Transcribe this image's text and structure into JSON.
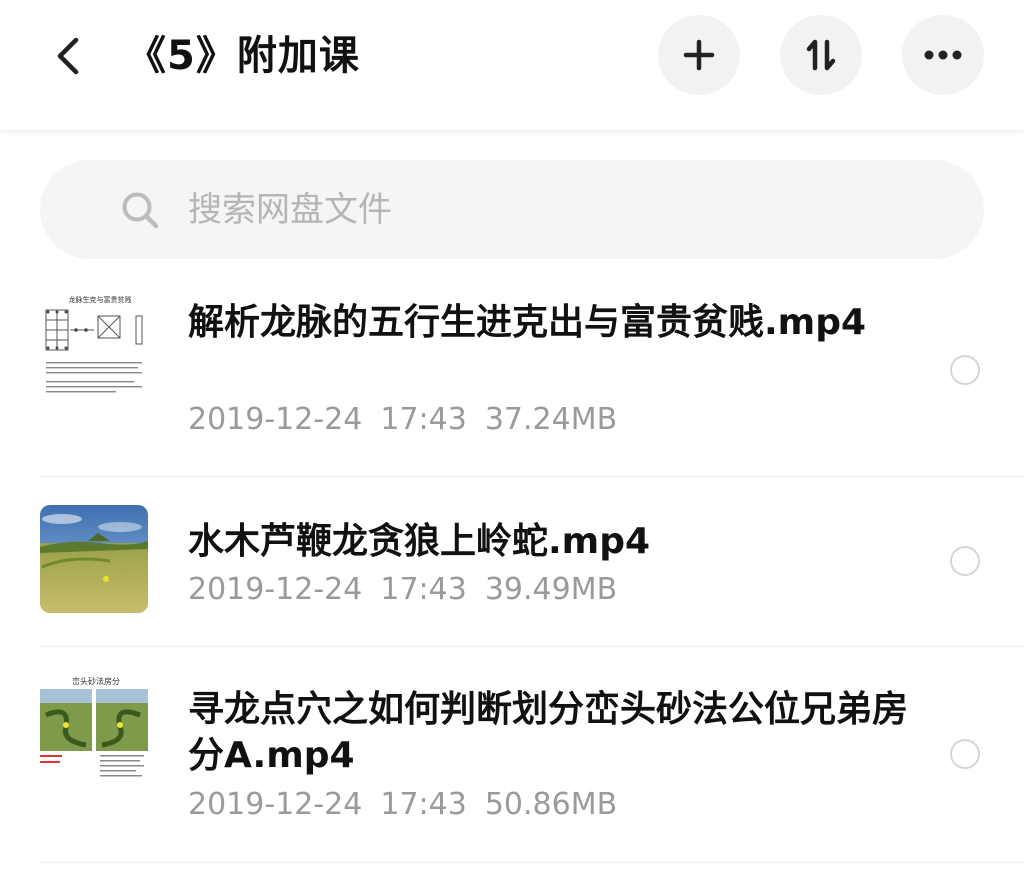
{
  "header": {
    "title": "《5》附加课",
    "back_icon": "chevron-left-icon",
    "add_icon": "plus-icon",
    "sort_icon": "sort-icon",
    "more_icon": "more-horizontal-icon"
  },
  "search": {
    "placeholder": "搜索网盘文件",
    "value": ""
  },
  "files": [
    {
      "name": "解析龙脉的五行生进克出与富贵贫贱.mp4",
      "date": "2019-12-24",
      "time": "17:43",
      "size": "37.24MB",
      "thumb_title": "龙脉生克与富贵贫贱"
    },
    {
      "name": "水木芦鞭龙贪狼上岭蛇.mp4",
      "date": "2019-12-24",
      "time": "17:43",
      "size": "39.49MB"
    },
    {
      "name": "寻龙点穴之如何判断划分峦头砂法公位兄弟房分A.mp4",
      "date": "2019-12-24",
      "time": "17:43",
      "size": "50.86MB",
      "thumb_title": "峦头砂法房分"
    }
  ],
  "colors": {
    "title_text": "#111111",
    "meta_text": "#9a9a9a",
    "button_bg": "#f2f2f2",
    "search_bg": "#f5f5f5",
    "placeholder": "#b5b5b5"
  }
}
